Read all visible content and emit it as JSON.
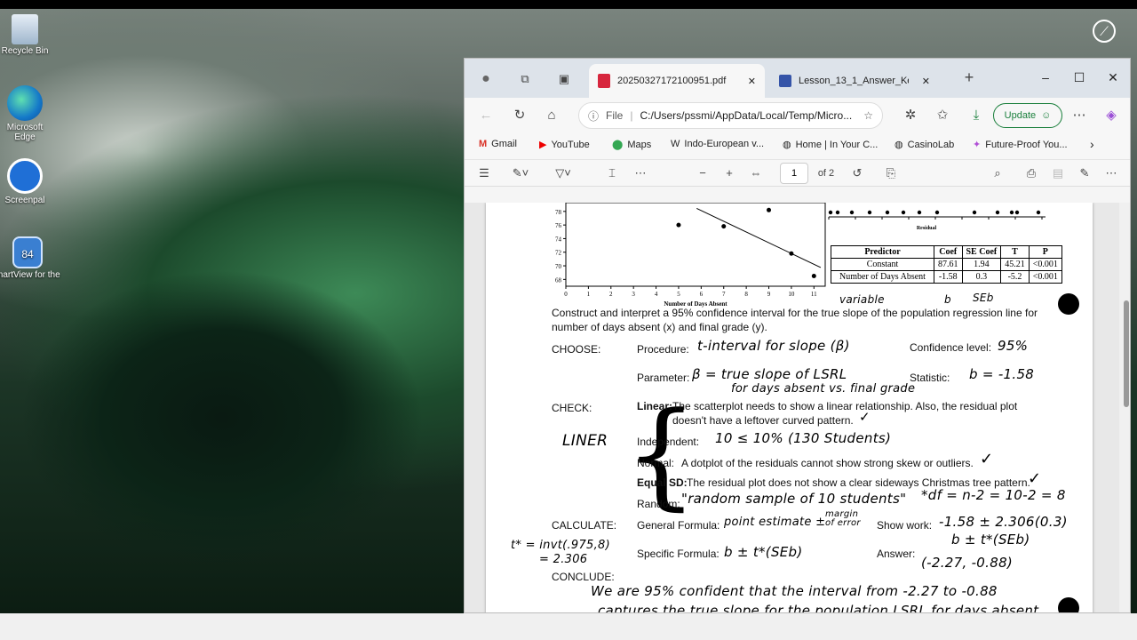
{
  "desktop": {
    "icons": [
      {
        "label": "Recycle Bin"
      },
      {
        "label": "Microsoft Edge"
      },
      {
        "label": "Screenpal"
      },
      {
        "label": "SmartView for the"
      }
    ],
    "badge": "84"
  },
  "browser": {
    "tabs": [
      {
        "title": "20250327172100951.pdf",
        "active": true
      },
      {
        "title": "Lesson_13_1_Answer_Key_A"
      }
    ],
    "address": {
      "scheme": "File",
      "path": "C:/Users/pssmi/AppData/Local/Temp/Micro..."
    },
    "update_label": "Update",
    "favorites": [
      {
        "label": "Gmail"
      },
      {
        "label": "YouTube"
      },
      {
        "label": "Maps"
      },
      {
        "label": "Indo-European v..."
      },
      {
        "label": "Home | In Your C..."
      },
      {
        "label": "CasinoLab"
      },
      {
        "label": "Future-Proof You..."
      }
    ],
    "pdf": {
      "page": "1",
      "of": "of 2"
    }
  },
  "document": {
    "chart": {
      "xlabel": "Number of Days Absent",
      "yticks": [
        "78",
        "76",
        "74",
        "72",
        "70",
        "68"
      ],
      "xticks": [
        "0",
        "1",
        "2",
        "3",
        "4",
        "5",
        "6",
        "7",
        "8",
        "9",
        "10",
        "11"
      ],
      "points": [
        [
          5,
          76
        ],
        [
          7,
          75.8
        ],
        [
          9,
          78.2
        ],
        [
          10,
          71.8
        ],
        [
          11,
          68.5
        ]
      ],
      "residual_label": "Residual"
    },
    "table": {
      "headers": [
        "Predictor",
        "Coef",
        "SE Coef",
        "T",
        "P"
      ],
      "rows": [
        [
          "Constant",
          "87.61",
          "1.94",
          "45.21",
          "<0.001"
        ],
        [
          "Number of Days Absent",
          "-1.58",
          "0.3",
          "-5.2",
          "<0.001"
        ]
      ]
    },
    "annotations": {
      "variable": "variable",
      "b": "b",
      "seb": "SEb"
    },
    "prompt": "Construct and interpret a 95% confidence interval for the true slope of the population regression line for number of days absent (x) and final grade (y).",
    "choose": {
      "label": "CHOOSE:",
      "procedure_label": "Procedure:",
      "procedure_hw": "t-interval for slope (β)",
      "conf_label": "Confidence level:",
      "conf_hw": "95%",
      "param_label": "Parameter:",
      "param_hw": "β = true slope of LSRL",
      "param_hw2": "for days absent vs. final grade",
      "stat_label": "Statistic:",
      "stat_hw": "b = -1.58"
    },
    "check": {
      "label": "CHECK:",
      "liner": "LINER",
      "linear_label": "Linear:",
      "linear_text": "The scatterplot needs to show a linear relationship. Also, the residual plot",
      "linear_text2": "doesn't have a leftover curved pattern.",
      "indep_label": "Independent:",
      "indep_hw": "10 ≤ 10% (130 Students)",
      "normal_label": "Normal:",
      "normal_text": "A dotplot of the residuals cannot show strong skew or outliers.",
      "eqsd_label": "Equal SD:",
      "eqsd_text": "The residual plot does not show a clear sideways Christmas tree pattern.",
      "random_label": "Random:",
      "random_hw": "\"random sample of 10 students\"",
      "df_hw": "*df = n-2 = 10-2 = 8",
      "check": "✓"
    },
    "calculate": {
      "label": "CALCULATE:",
      "general_label": "General Formula:",
      "general_hw": "point estimate ±",
      "moe_hw": "margin of error",
      "show_label": "Show work:",
      "show_hw": "-1.58 ± 2.306(0.3)",
      "show_hw2": "b ± t*(SEb)",
      "specific_label": "Specific Formula:",
      "specific_hw": "b ± t*(SEb)",
      "answer_label": "Answer:",
      "answer_hw": "(-2.27, -0.88)",
      "tstar_hw": "t* = invt(.975,8)",
      "tstar_hw2": "= 2.306"
    },
    "conclude": {
      "label": "CONCLUDE:",
      "hw": "We are 95% confident that the interval from -2.27 to -0.88",
      "hw2": "captures the true slope for the population LSRL for days absent"
    }
  }
}
